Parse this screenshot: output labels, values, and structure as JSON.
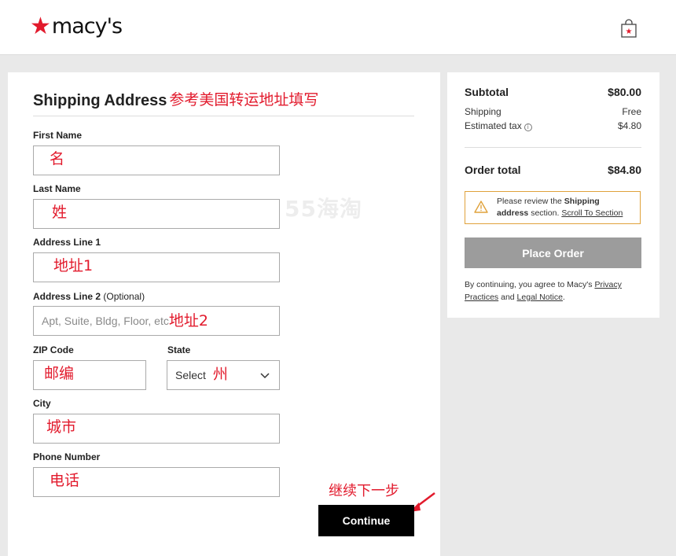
{
  "header": {
    "logo_text": "macy's",
    "bag_icon": "shopping-bag-icon"
  },
  "shipping": {
    "title": "Shipping Address",
    "title_note": "参考美国转运地址填写",
    "fields": {
      "first_name": {
        "label": "First Name",
        "note": "名"
      },
      "last_name": {
        "label": "Last Name",
        "note": "姓"
      },
      "address1": {
        "label": "Address Line 1",
        "note": "地址1"
      },
      "address2": {
        "label": "Address Line 2",
        "optional": "(Optional)",
        "placeholder": "Apt, Suite, Bldg, Floor, etc",
        "note": "地址2"
      },
      "zip": {
        "label": "ZIP Code",
        "note": "邮编"
      },
      "state": {
        "label": "State",
        "value": "Select",
        "note": "州"
      },
      "city": {
        "label": "City",
        "note": "城市"
      },
      "phone": {
        "label": "Phone Number",
        "note": "电话"
      }
    },
    "continue_note": "继续下一步",
    "continue_label": "Continue"
  },
  "watermark": "55海淘",
  "summary": {
    "subtotal_label": "Subtotal",
    "subtotal_value": "$80.00",
    "shipping_label": "Shipping",
    "shipping_value": "Free",
    "tax_label": "Estimated tax",
    "tax_value": "$4.80",
    "total_label": "Order total",
    "total_value": "$84.80",
    "alert": {
      "text1": "Please review the ",
      "bold1": "Shipping",
      "bold2": "address",
      "text2": " section. ",
      "link": "Scroll To Section"
    },
    "place_order_label": "Place Order",
    "legal": {
      "prefix": "By continuing, you agree to Macy's ",
      "privacy": "Privacy Practices",
      "and": " and ",
      "legal_notice": "Legal Notice",
      "suffix": "."
    }
  },
  "colors": {
    "brand_red": "#e21a2c",
    "alert_border": "#e0a23b",
    "disabled_button": "#9c9c9c"
  }
}
